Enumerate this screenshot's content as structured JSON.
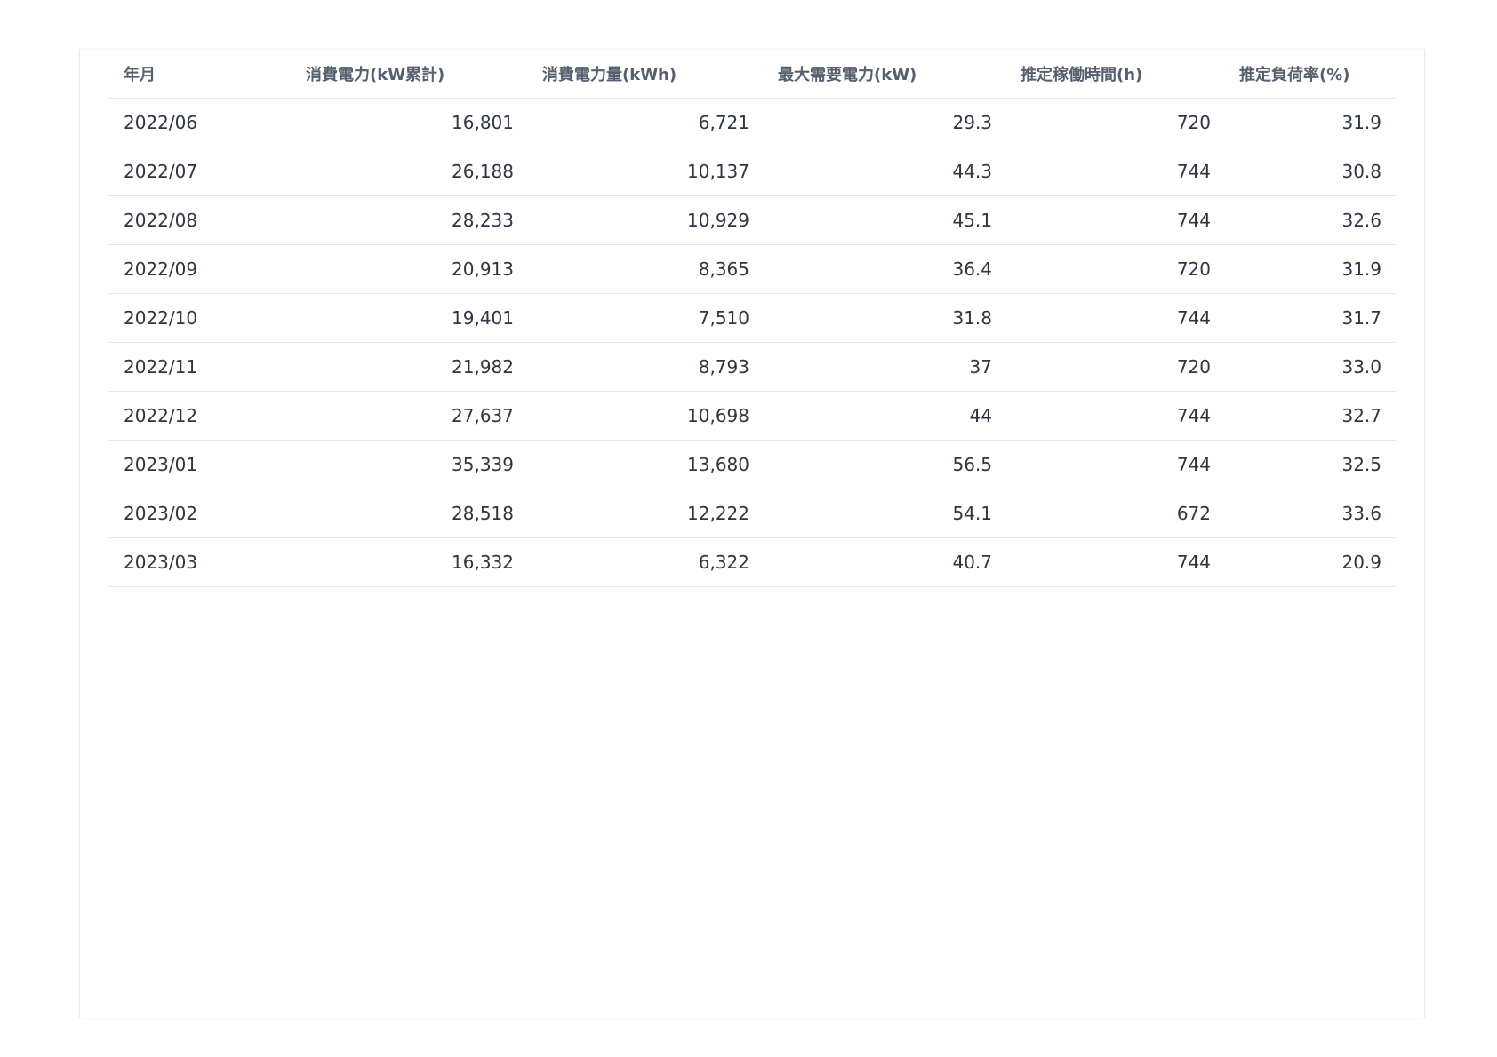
{
  "table": {
    "headers": [
      "年月",
      "消費電力(kW累計)",
      "消費電力量(kWh)",
      "最大需要電力(kW)",
      "推定稼働時間(h)",
      "推定負荷率(%)"
    ],
    "rows": [
      [
        "2022/06",
        "16,801",
        "6,721",
        "29.3",
        "720",
        "31.9"
      ],
      [
        "2022/07",
        "26,188",
        "10,137",
        "44.3",
        "744",
        "30.8"
      ],
      [
        "2022/08",
        "28,233",
        "10,929",
        "45.1",
        "744",
        "32.6"
      ],
      [
        "2022/09",
        "20,913",
        "8,365",
        "36.4",
        "720",
        "31.9"
      ],
      [
        "2022/10",
        "19,401",
        "7,510",
        "31.8",
        "744",
        "31.7"
      ],
      [
        "2022/11",
        "21,982",
        "8,793",
        "37",
        "720",
        "33.0"
      ],
      [
        "2022/12",
        "27,637",
        "10,698",
        "44",
        "744",
        "32.7"
      ],
      [
        "2023/01",
        "35,339",
        "13,680",
        "56.5",
        "744",
        "32.5"
      ],
      [
        "2023/02",
        "28,518",
        "12,222",
        "54.1",
        "672",
        "33.6"
      ],
      [
        "2023/03",
        "16,332",
        "6,322",
        "40.7",
        "744",
        "20.9"
      ]
    ]
  }
}
